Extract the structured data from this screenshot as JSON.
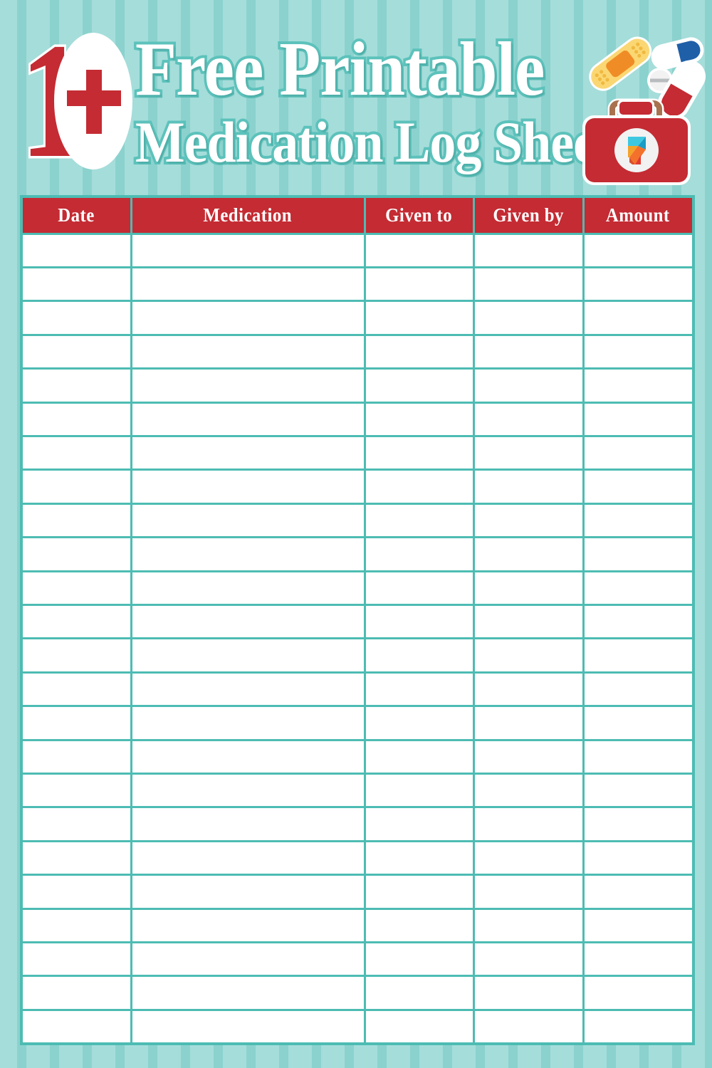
{
  "page": {
    "background_color": "#a5ddda",
    "stripe_color": "#8bd2ce",
    "accent_red": "#c42b33",
    "accent_teal": "#4dbcb3",
    "outline_teal": "#5cc2bb"
  },
  "header": {
    "badge_number": "1",
    "badge_plus": "+",
    "badge_full": "10+",
    "title_line1": "Free Printable",
    "title_line2": "Medication Log Sheets"
  },
  "illustration": {
    "name": "first-aid-kit-with-pills",
    "items": [
      "adhesive-bandage-icon",
      "blue-white-capsule-icon",
      "white-tablet-icon",
      "red-white-capsule-icon",
      "first-aid-kit-icon",
      "origami-logo-icon"
    ],
    "kit_color": "#c42b33",
    "bandage_color": "#fbd773",
    "bandage_pad_color": "#f08c25",
    "capsule_blue": "#1f5fa8",
    "capsule_red": "#c42b33"
  },
  "table": {
    "columns": [
      {
        "key": "date",
        "label": "Date"
      },
      {
        "key": "med",
        "label": "Medication"
      },
      {
        "key": "given_to",
        "label": "Given to"
      },
      {
        "key": "given_by",
        "label": "Given by"
      },
      {
        "key": "amount",
        "label": "Amount"
      }
    ],
    "row_count": 24,
    "rows": [
      {
        "date": "",
        "med": "",
        "given_to": "",
        "given_by": "",
        "amount": ""
      },
      {
        "date": "",
        "med": "",
        "given_to": "",
        "given_by": "",
        "amount": ""
      },
      {
        "date": "",
        "med": "",
        "given_to": "",
        "given_by": "",
        "amount": ""
      },
      {
        "date": "",
        "med": "",
        "given_to": "",
        "given_by": "",
        "amount": ""
      },
      {
        "date": "",
        "med": "",
        "given_to": "",
        "given_by": "",
        "amount": ""
      },
      {
        "date": "",
        "med": "",
        "given_to": "",
        "given_by": "",
        "amount": ""
      },
      {
        "date": "",
        "med": "",
        "given_to": "",
        "given_by": "",
        "amount": ""
      },
      {
        "date": "",
        "med": "",
        "given_to": "",
        "given_by": "",
        "amount": ""
      },
      {
        "date": "",
        "med": "",
        "given_to": "",
        "given_by": "",
        "amount": ""
      },
      {
        "date": "",
        "med": "",
        "given_to": "",
        "given_by": "",
        "amount": ""
      },
      {
        "date": "",
        "med": "",
        "given_to": "",
        "given_by": "",
        "amount": ""
      },
      {
        "date": "",
        "med": "",
        "given_to": "",
        "given_by": "",
        "amount": ""
      },
      {
        "date": "",
        "med": "",
        "given_to": "",
        "given_by": "",
        "amount": ""
      },
      {
        "date": "",
        "med": "",
        "given_to": "",
        "given_by": "",
        "amount": ""
      },
      {
        "date": "",
        "med": "",
        "given_to": "",
        "given_by": "",
        "amount": ""
      },
      {
        "date": "",
        "med": "",
        "given_to": "",
        "given_by": "",
        "amount": ""
      },
      {
        "date": "",
        "med": "",
        "given_to": "",
        "given_by": "",
        "amount": ""
      },
      {
        "date": "",
        "med": "",
        "given_to": "",
        "given_by": "",
        "amount": ""
      },
      {
        "date": "",
        "med": "",
        "given_to": "",
        "given_by": "",
        "amount": ""
      },
      {
        "date": "",
        "med": "",
        "given_to": "",
        "given_by": "",
        "amount": ""
      },
      {
        "date": "",
        "med": "",
        "given_to": "",
        "given_by": "",
        "amount": ""
      },
      {
        "date": "",
        "med": "",
        "given_to": "",
        "given_by": "",
        "amount": ""
      },
      {
        "date": "",
        "med": "",
        "given_to": "",
        "given_by": "",
        "amount": ""
      },
      {
        "date": "",
        "med": "",
        "given_to": "",
        "given_by": "",
        "amount": ""
      }
    ]
  }
}
